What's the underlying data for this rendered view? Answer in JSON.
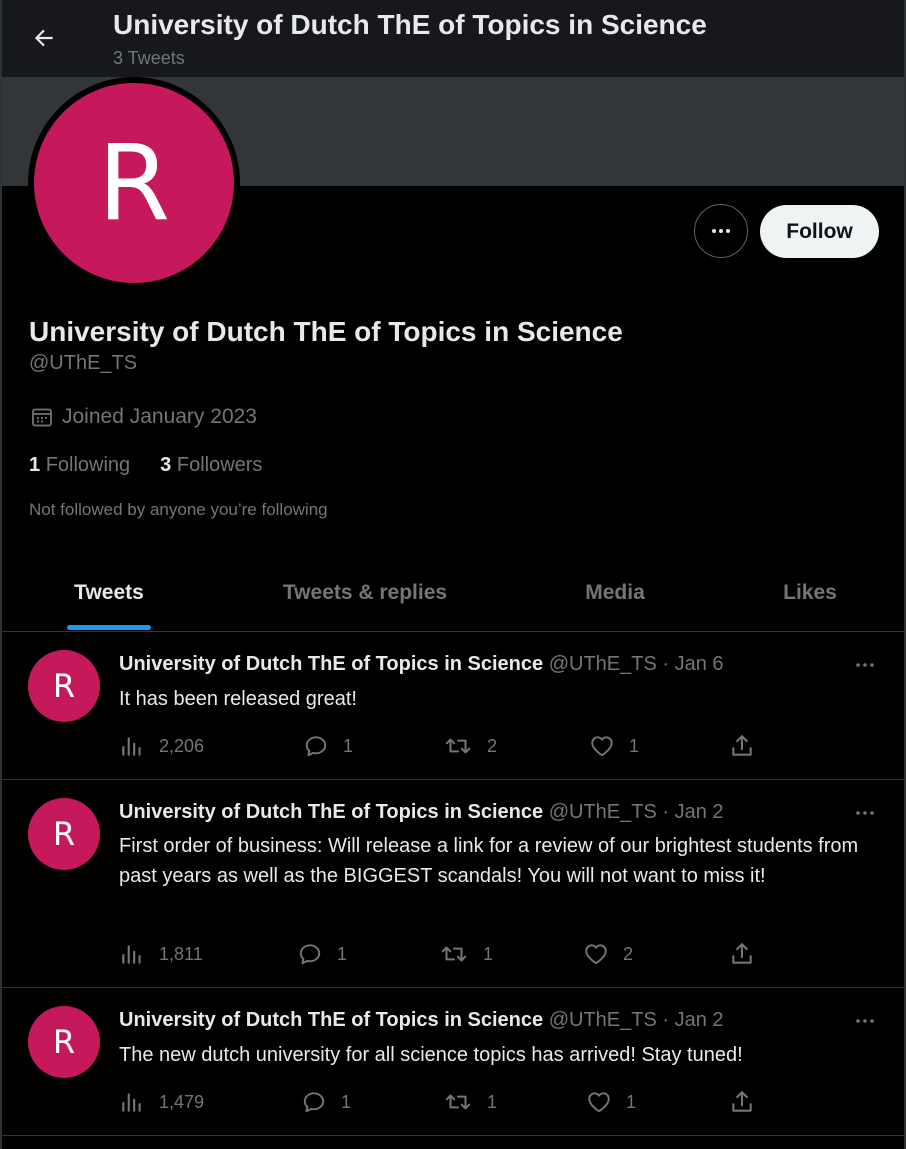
{
  "header": {
    "title": "University of Dutch ThE of Topics in Science",
    "tweet_count": "3 Tweets"
  },
  "profile": {
    "avatar_letter": "R",
    "name": "University of Dutch ThE of Topics in Science",
    "handle": "@UThE_TS",
    "joined": "Joined January 2023",
    "following_count": "1",
    "following_label": "Following",
    "followers_count": "3",
    "followers_label": "Followers",
    "not_followed": "Not followed by anyone you’re following",
    "follow_label": "Follow"
  },
  "tabs": [
    {
      "label": "Tweets",
      "active": true
    },
    {
      "label": "Tweets & replies",
      "active": false
    },
    {
      "label": "Media",
      "active": false
    },
    {
      "label": "Likes",
      "active": false
    }
  ],
  "tweets": [
    {
      "avatar_letter": "R",
      "name": "University of Dutch ThE of Topics in Science",
      "handle": "@UThE_TS",
      "date": "Jan 6",
      "text": "It has been released great!",
      "views": "2,206",
      "replies": "1",
      "retweets": "2",
      "likes": "1"
    },
    {
      "avatar_letter": "R",
      "name": "University of Dutch ThE of Topics in Science",
      "handle": "@UThE_TS",
      "date": "Jan 2",
      "text": "First order of business: Will release a link for a review of our brightest students from past years as well as the BIGGEST scandals! You will not want to miss it!",
      "views": "1,811",
      "replies": "1",
      "retweets": "1",
      "likes": "2"
    },
    {
      "avatar_letter": "R",
      "name": "University of Dutch ThE of Topics in Science",
      "handle": "@UThE_TS",
      "date": "Jan 2",
      "text": "The new dutch university for all science topics has arrived! Stay tuned!",
      "views": "1,479",
      "replies": "1",
      "retweets": "1",
      "likes": "1"
    }
  ],
  "colors": {
    "accent": "#1d9bf0",
    "avatar": "#c6195c",
    "background": "#000000",
    "muted_text": "#71767b"
  },
  "icons": [
    "back-arrow-icon",
    "more-dots-icon",
    "calendar-icon",
    "views-icon",
    "reply-icon",
    "retweet-icon",
    "like-icon",
    "share-icon"
  ]
}
